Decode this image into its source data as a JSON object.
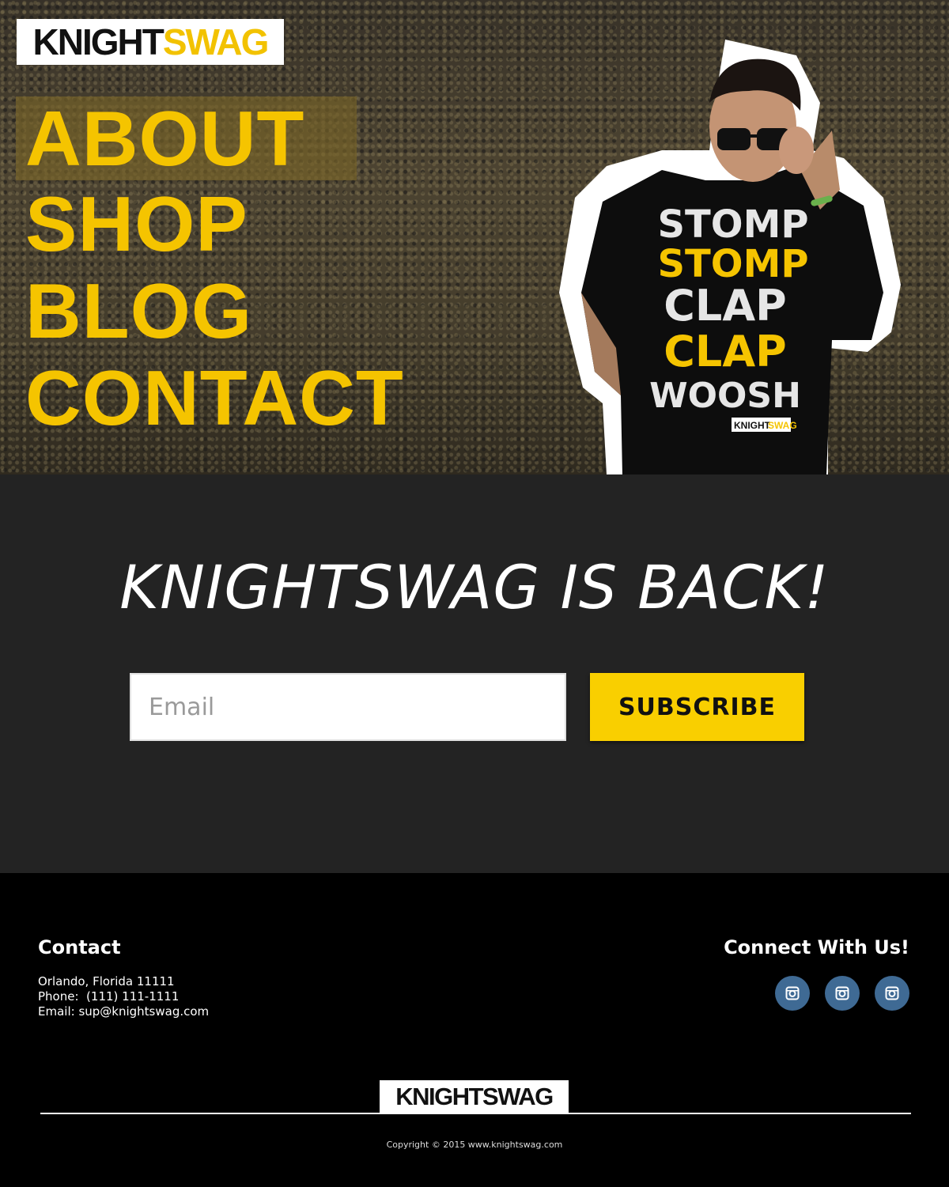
{
  "brand": {
    "knight": "KNIGHT",
    "swag": "SWAG"
  },
  "nav": {
    "items": [
      {
        "label": "ABOUT"
      },
      {
        "label": "SHOP"
      },
      {
        "label": "BLOG"
      },
      {
        "label": "CONTACT"
      }
    ]
  },
  "shirt": {
    "lines": [
      "STOMP",
      "STOMP",
      "CLAP",
      "CLAP",
      "WOOSH"
    ]
  },
  "subscribe": {
    "headline": "KNIGHTSWAG IS BACK!",
    "email_placeholder": "Email",
    "button_label": "SUBSCRIBE"
  },
  "footer": {
    "contact_title": "Contact",
    "address": "Orlando, Florida 11111",
    "phone": "Phone:  (111) 111-1111",
    "email": "Email: sup@knightswag.com",
    "connect_title": "Connect With Us!",
    "social": [
      {
        "icon": "instagram-icon"
      },
      {
        "icon": "instagram-icon"
      },
      {
        "icon": "instagram-icon"
      }
    ],
    "copyright": "Copyright © 2015 www.knightswag.com"
  },
  "colors": {
    "accent_yellow": "#f9cf00",
    "dark_section": "#232323",
    "social_blue": "#3f6a94"
  }
}
